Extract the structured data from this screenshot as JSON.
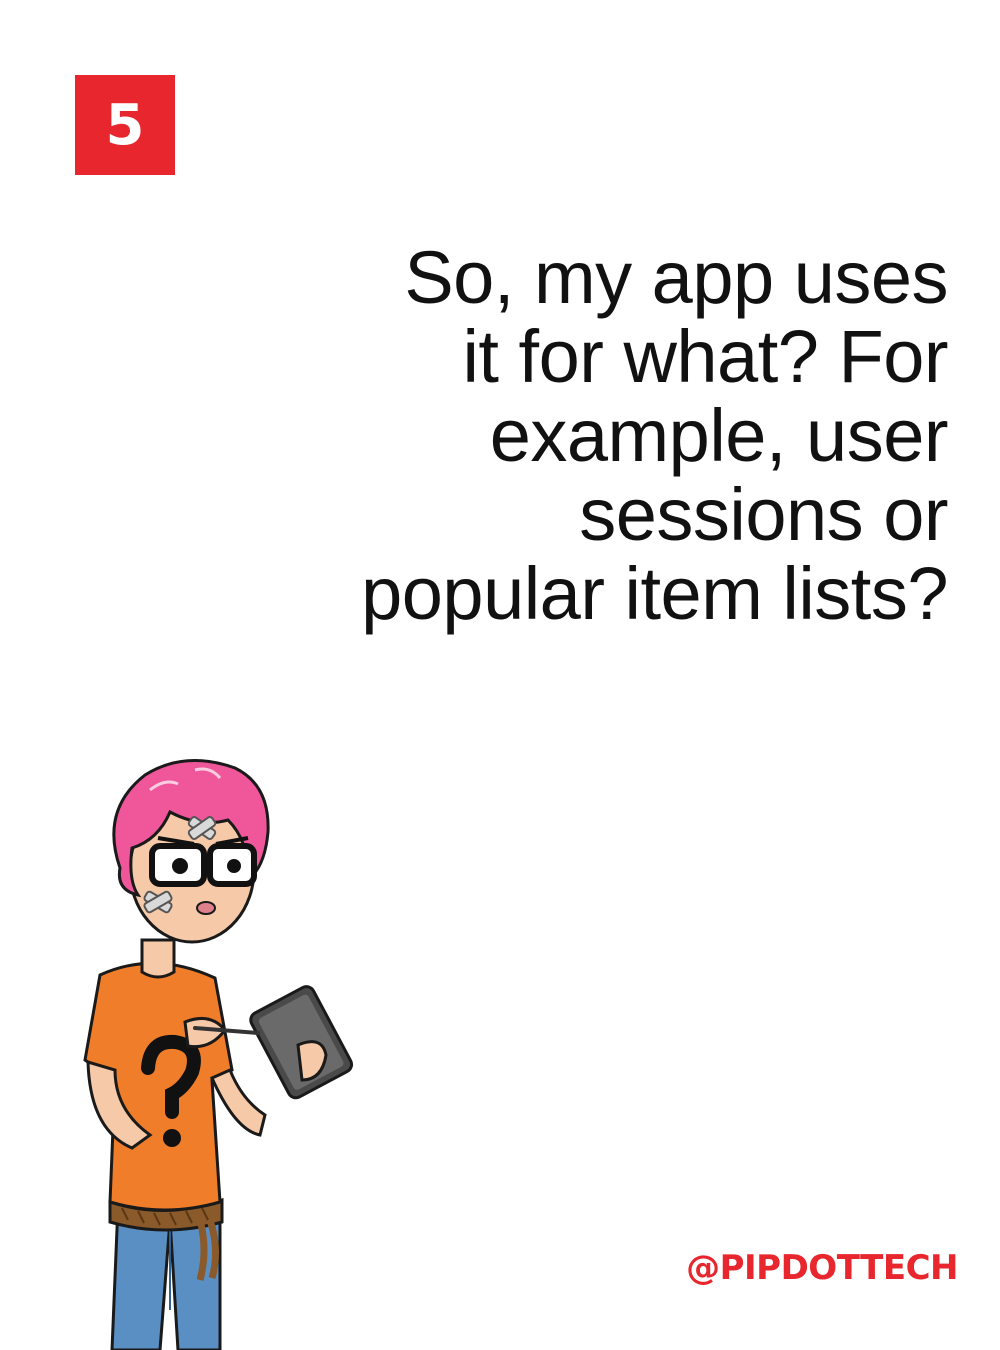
{
  "slide": {
    "number": "5",
    "question_lines": [
      "So, my app uses",
      "it for what? For",
      "example, user",
      "sessions or",
      "popular item lists?"
    ],
    "handle": "@PIPDOTTECH"
  },
  "colors": {
    "accent": "#e8262d",
    "text": "#111111",
    "background": "#ffffff",
    "hair": "#f0579a",
    "shirt": "#f07d2a",
    "jeans": "#5a8fc4"
  },
  "illustration": {
    "subject": "pink-haired person with glasses holding a tablet and stylus"
  }
}
